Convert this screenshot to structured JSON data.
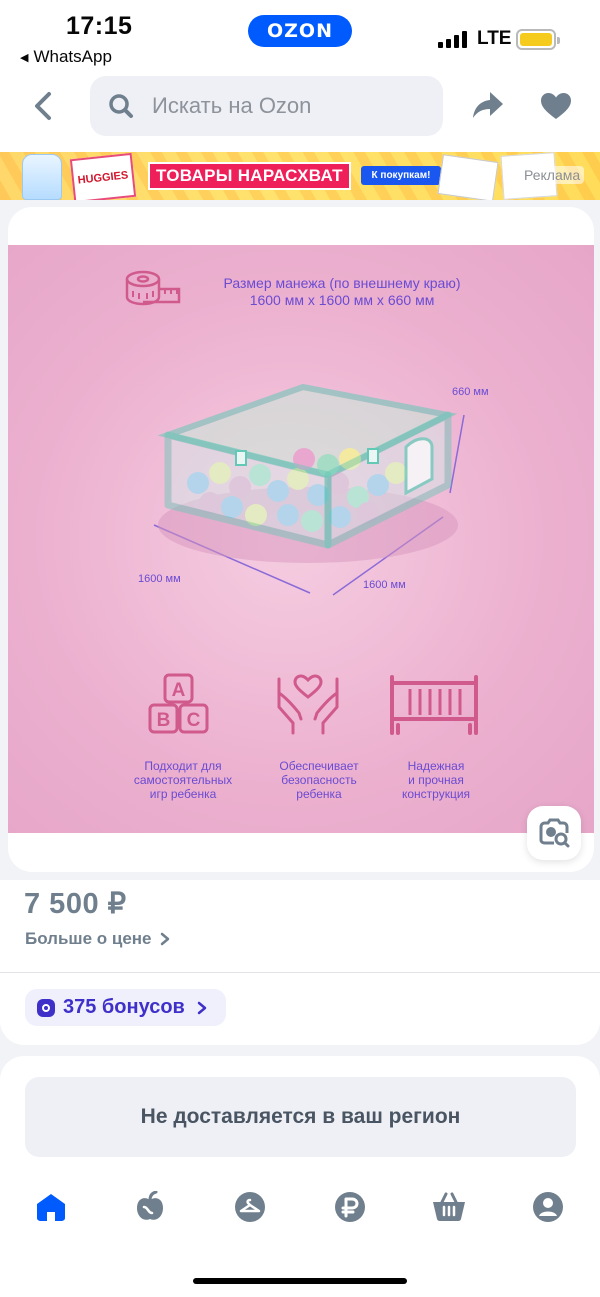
{
  "status_bar": {
    "time": "17:15",
    "back_app": "WhatsApp",
    "brand": "OZON",
    "network": "LTE"
  },
  "header": {
    "search_placeholder": "Искать на Ozon",
    "icons": [
      "chevron-left-icon",
      "search-icon",
      "share-icon",
      "heart-icon"
    ]
  },
  "ad": {
    "title": "ТОВАРЫ НАРАСХВАТ",
    "cta": "К покупкам!",
    "label": "Реклама",
    "brand_text": "HUGGIES"
  },
  "product_image": {
    "size_title_line1": "Размер манежа (по внешнему краю)",
    "size_title_line2": "1600 мм х 1600 мм х 660 мм",
    "dim_height": "660 мм",
    "dim_left": "1600 мм",
    "dim_right": "1600 мм",
    "abc_letters": [
      "A",
      "B",
      "C"
    ],
    "features": [
      {
        "line1": "Подходит для",
        "line2": "самостоятельных",
        "line3": "игр ребенка"
      },
      {
        "line1": "Обеспечивает",
        "line2": "безопасность",
        "line3": "ребенка"
      },
      {
        "line1": "Надежная",
        "line2": "и прочная",
        "line3": "конструкция"
      }
    ]
  },
  "price": {
    "value": "7 500 ₽",
    "more_label": "Больше о цене"
  },
  "bonus": {
    "label": "375 бонусов"
  },
  "delivery": {
    "message": "Не доставляется в ваш регион"
  },
  "tabbar": {
    "icons": [
      "home-icon",
      "fresh-icon",
      "clothes-icon",
      "ruble-icon",
      "cart-icon",
      "profile-icon"
    ],
    "active": "home-icon"
  },
  "colors": {
    "brand_blue": "#005bff",
    "bonus_purple": "#3f30c9",
    "photo_pink": "#ecb0cf",
    "text_gray": "#707f8d"
  }
}
